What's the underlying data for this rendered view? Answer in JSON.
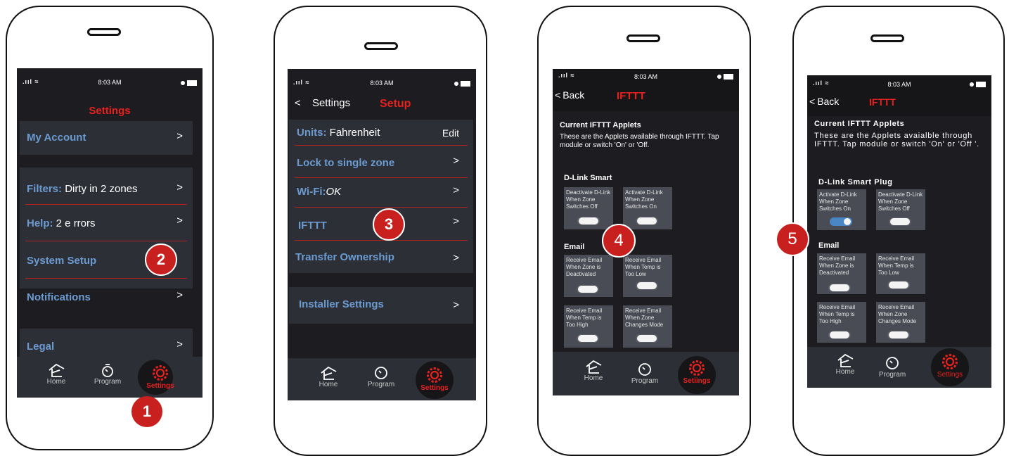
{
  "status_bar": {
    "time": "8:03 AM"
  },
  "tabs": {
    "home": "Home",
    "program": "Program",
    "settings": "Settings"
  },
  "screen1": {
    "title": "Settings",
    "rows": [
      {
        "label": "My Account",
        "value": ""
      },
      {
        "label": "Filters:",
        "value": "Dirty in 2 zones"
      },
      {
        "label": "Help:",
        "value": "2 e rrors"
      },
      {
        "label": "System Setup",
        "value": ""
      },
      {
        "label": "Notifications",
        "value": ""
      },
      {
        "label": "Legal",
        "value": ""
      }
    ],
    "badges": [
      "1",
      "2"
    ]
  },
  "screen2": {
    "back_label": "Settings",
    "title": "Setup",
    "units_label": "Units:",
    "units_value": "Fahrenheit",
    "edit_label": "Edit",
    "rows": [
      "Lock to single zone",
      "Wi-Fi:",
      "IFTTT",
      "Transfer Ownership"
    ],
    "wifi_value": "OK",
    "installer_label": "Installer Settings",
    "badge": "3"
  },
  "screen3": {
    "back_label": "Back",
    "title": "IFTTT",
    "heading": "Current IFTTT Applets",
    "description": "These  are the Applets available through IFTTT. Tap module or switch 'On' or 'Off.",
    "section1": "D-Link Smart",
    "cards1": [
      "Deactivate D-Link When Zone Switches Off",
      "Activate D-Link When Zone Switches On"
    ],
    "section2": "Email",
    "cards2": [
      "Receive Email When Zone is Deactivated",
      "Receive Email When Temp is Too Low",
      "Receive Email When Temp is Too High",
      "Receive Email When Zone Changes Mode"
    ],
    "badge": "4",
    "settings_tab": "Setiings"
  },
  "screen4": {
    "back_label": "Back",
    "title": "IFTTT",
    "heading": "Current IFTTT Applets",
    "description": "These are the Applets avaialble through IFTTT. Tap module or switch 'On' or  'Off  '.",
    "section1": "D-Link Smart Plug",
    "cards1": [
      "Activate D-Link When Zone Switches On",
      "Deactivate D-Link When Zone Switches Off"
    ],
    "section2": "Email",
    "cards2": [
      "Receive Email When Zone is Deactivated",
      "Receive Email When Temp is Too Low",
      "Receive Email When Temp is Too High",
      "Receive Email When Zone Changes Mode"
    ],
    "badge": "5"
  },
  "colors": {
    "accent_red": "#e8211f",
    "link_blue": "#6b9bd1",
    "screen_bg": "#1d1d21",
    "toggle_on": "#4a86c5"
  }
}
